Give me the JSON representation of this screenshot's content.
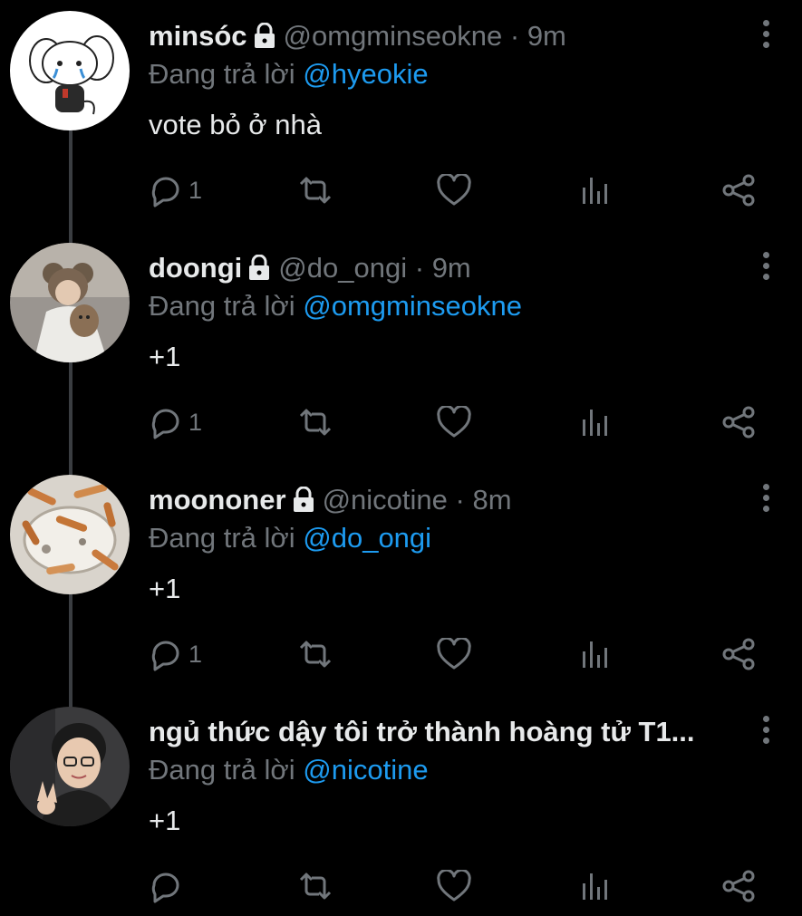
{
  "tweets": [
    {
      "name": "minsóc",
      "handle": "@omgminseokne",
      "time": "9m",
      "replying_label": "Đang trả lời",
      "replying_to": "@hyeokie",
      "text": "vote bỏ ở nhà",
      "reply_count": "1",
      "locked": true
    },
    {
      "name": "doongi",
      "handle": "@do_ongi",
      "time": "9m",
      "replying_label": "Đang trả lời",
      "replying_to": "@omgminseokne",
      "text": "+1",
      "reply_count": "1",
      "locked": true
    },
    {
      "name": "moononer",
      "handle": "@nicotine",
      "time": "8m",
      "replying_label": "Đang trả lời",
      "replying_to": "@do_ongi",
      "text": "+1",
      "reply_count": "1",
      "locked": true
    },
    {
      "name": "ngủ thức dậy tôi trở thành hoàng tử T1...",
      "handle": "",
      "time": "",
      "replying_label": "Đang trả lời",
      "replying_to": "@nicotine",
      "text": "+1",
      "reply_count": "",
      "locked": false
    }
  ],
  "separator": "·",
  "colors": {
    "background": "#000000",
    "text": "#e7e9ea",
    "muted": "#71767b",
    "link": "#1d9bf0",
    "thread_line": "#3a3d41"
  },
  "icons": [
    "lock-icon",
    "more-options-icon",
    "reply-icon",
    "retweet-icon",
    "like-icon",
    "views-icon",
    "share-icon"
  ]
}
